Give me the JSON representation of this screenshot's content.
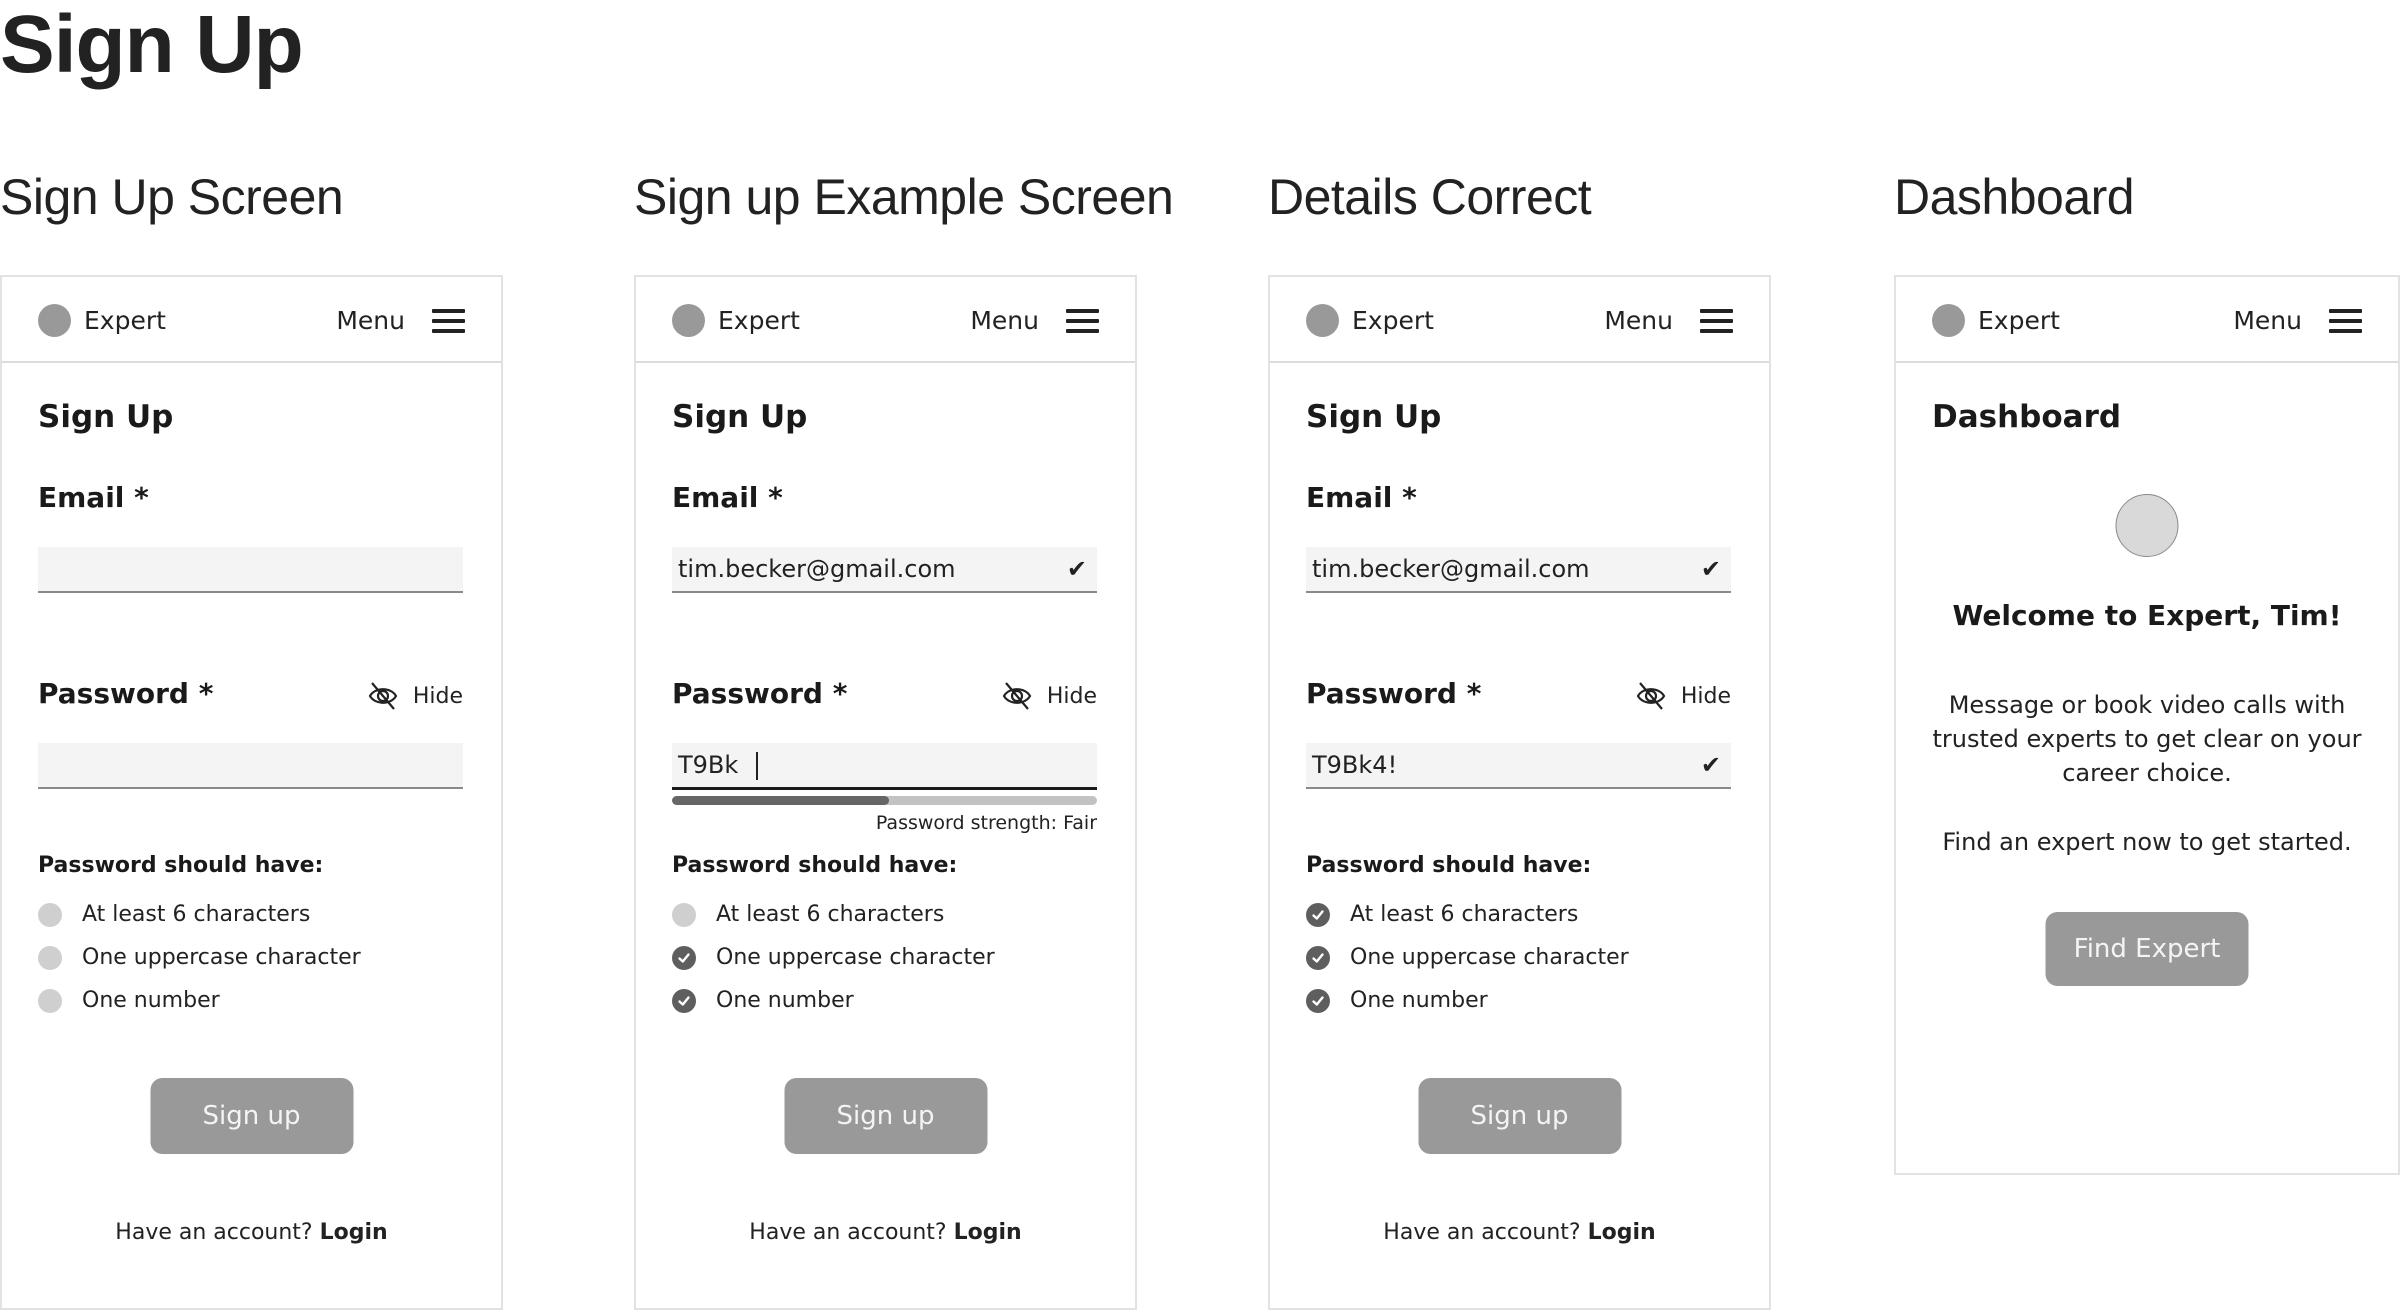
{
  "page": {
    "title": "Sign Up"
  },
  "header": {
    "brand": "Expert",
    "menu_label": "Menu"
  },
  "colors": {
    "button_bg": "#999999",
    "check_done": "#5e5e5e",
    "check_pending": "#cfcfcf",
    "field_bg": "#f4f4f4"
  },
  "screens": [
    {
      "title": "Sign Up Screen",
      "heading": "Sign Up",
      "email_label": "Email *",
      "email_value": "",
      "password_label": "Password *",
      "hide_label": "Hide",
      "password_value": "",
      "requirements_heading": "Password should have:",
      "requirements": [
        {
          "label": "At least 6 characters",
          "met": false
        },
        {
          "label": "One uppercase character",
          "met": false
        },
        {
          "label": "One number",
          "met": false
        }
      ],
      "signup_label": "Sign up",
      "login_prompt": "Have an account?",
      "login_link": "Login"
    },
    {
      "title": "Sign up Example Screen",
      "heading": "Sign Up",
      "email_label": "Email *",
      "email_value": "tim.becker@gmail.com",
      "email_valid": true,
      "password_label": "Password *",
      "hide_label": "Hide",
      "password_value": "T9Bk",
      "password_strength_label": "Password strength: Fair",
      "password_strength_percent": 51,
      "requirements_heading": "Password should have:",
      "requirements": [
        {
          "label": "At least 6 characters",
          "met": false
        },
        {
          "label": "One uppercase character",
          "met": true
        },
        {
          "label": "One number",
          "met": true
        }
      ],
      "signup_label": "Sign up",
      "login_prompt": "Have an account?",
      "login_link": "Login"
    },
    {
      "title": "Details Correct",
      "heading": "Sign Up",
      "email_label": "Email *",
      "email_value": "tim.becker@gmail.com",
      "email_valid": true,
      "password_label": "Password *",
      "hide_label": "Hide",
      "password_value": "T9Bk4!",
      "password_valid": true,
      "requirements_heading": "Password should have:",
      "requirements": [
        {
          "label": "At least 6 characters",
          "met": true
        },
        {
          "label": "One uppercase character",
          "met": true
        },
        {
          "label": "One number",
          "met": true
        }
      ],
      "signup_label": "Sign up",
      "login_prompt": "Have an account?",
      "login_link": "Login"
    },
    {
      "title": "Dashboard",
      "heading": "Dashboard",
      "welcome": "Welcome to Expert, Tim!",
      "description": "Message or book video calls with trusted experts to get clear on your career choice.",
      "cta_text": "Find an expert now to get started.",
      "button_label": "Find Expert"
    }
  ],
  "icons": {
    "logo": "logo-circle-icon",
    "menu": "hamburger-menu-icon",
    "hide": "eye-slash-icon",
    "valid": "checkmark-icon",
    "requirement_met": "check-circle-icon",
    "requirement_pending": "empty-circle-icon",
    "avatar": "avatar-placeholder-icon"
  }
}
